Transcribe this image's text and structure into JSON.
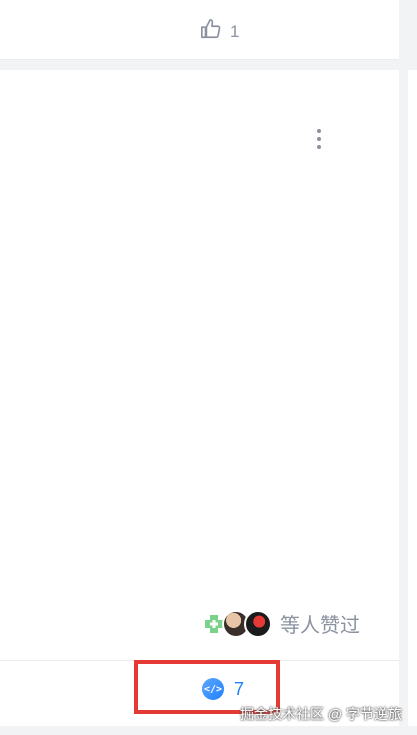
{
  "top_card": {
    "like_count": "1"
  },
  "post": {
    "liked_by_text": "等人赞过",
    "code_count": "7"
  },
  "watermark": "掘金技术社区 @ 字节逆旅",
  "colors": {
    "accent": "#1e80ff",
    "highlight": "#e53935",
    "muted": "#8a919f"
  },
  "icons": {
    "like": "thumbs-up-icon",
    "more": "more-vertical-icon",
    "code": "code-icon"
  }
}
